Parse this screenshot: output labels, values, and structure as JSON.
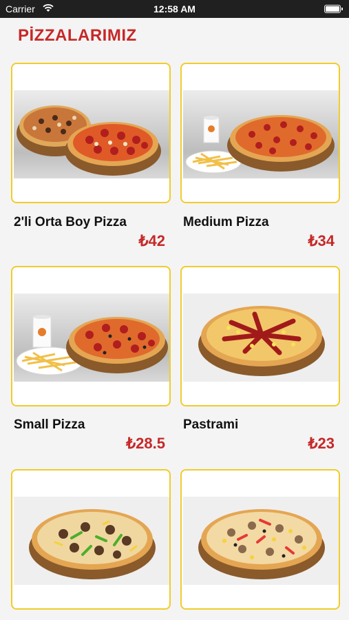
{
  "status_bar": {
    "carrier": "Carrier",
    "time": "12:58 AM"
  },
  "header": {
    "title": "PİZZALARIMIZ"
  },
  "products": [
    {
      "name": "2'li Orta Boy Pizza",
      "price": "₺42"
    },
    {
      "name": "Medium Pizza",
      "price": "₺34"
    },
    {
      "name": "Small Pizza",
      "price": "₺28.5"
    },
    {
      "name": "Pastrami",
      "price": "₺23"
    },
    {
      "name": "",
      "price": ""
    },
    {
      "name": "",
      "price": ""
    }
  ],
  "colors": {
    "accent": "#c62828",
    "card_border": "#f1cc2a",
    "background": "#f4f4f4"
  }
}
